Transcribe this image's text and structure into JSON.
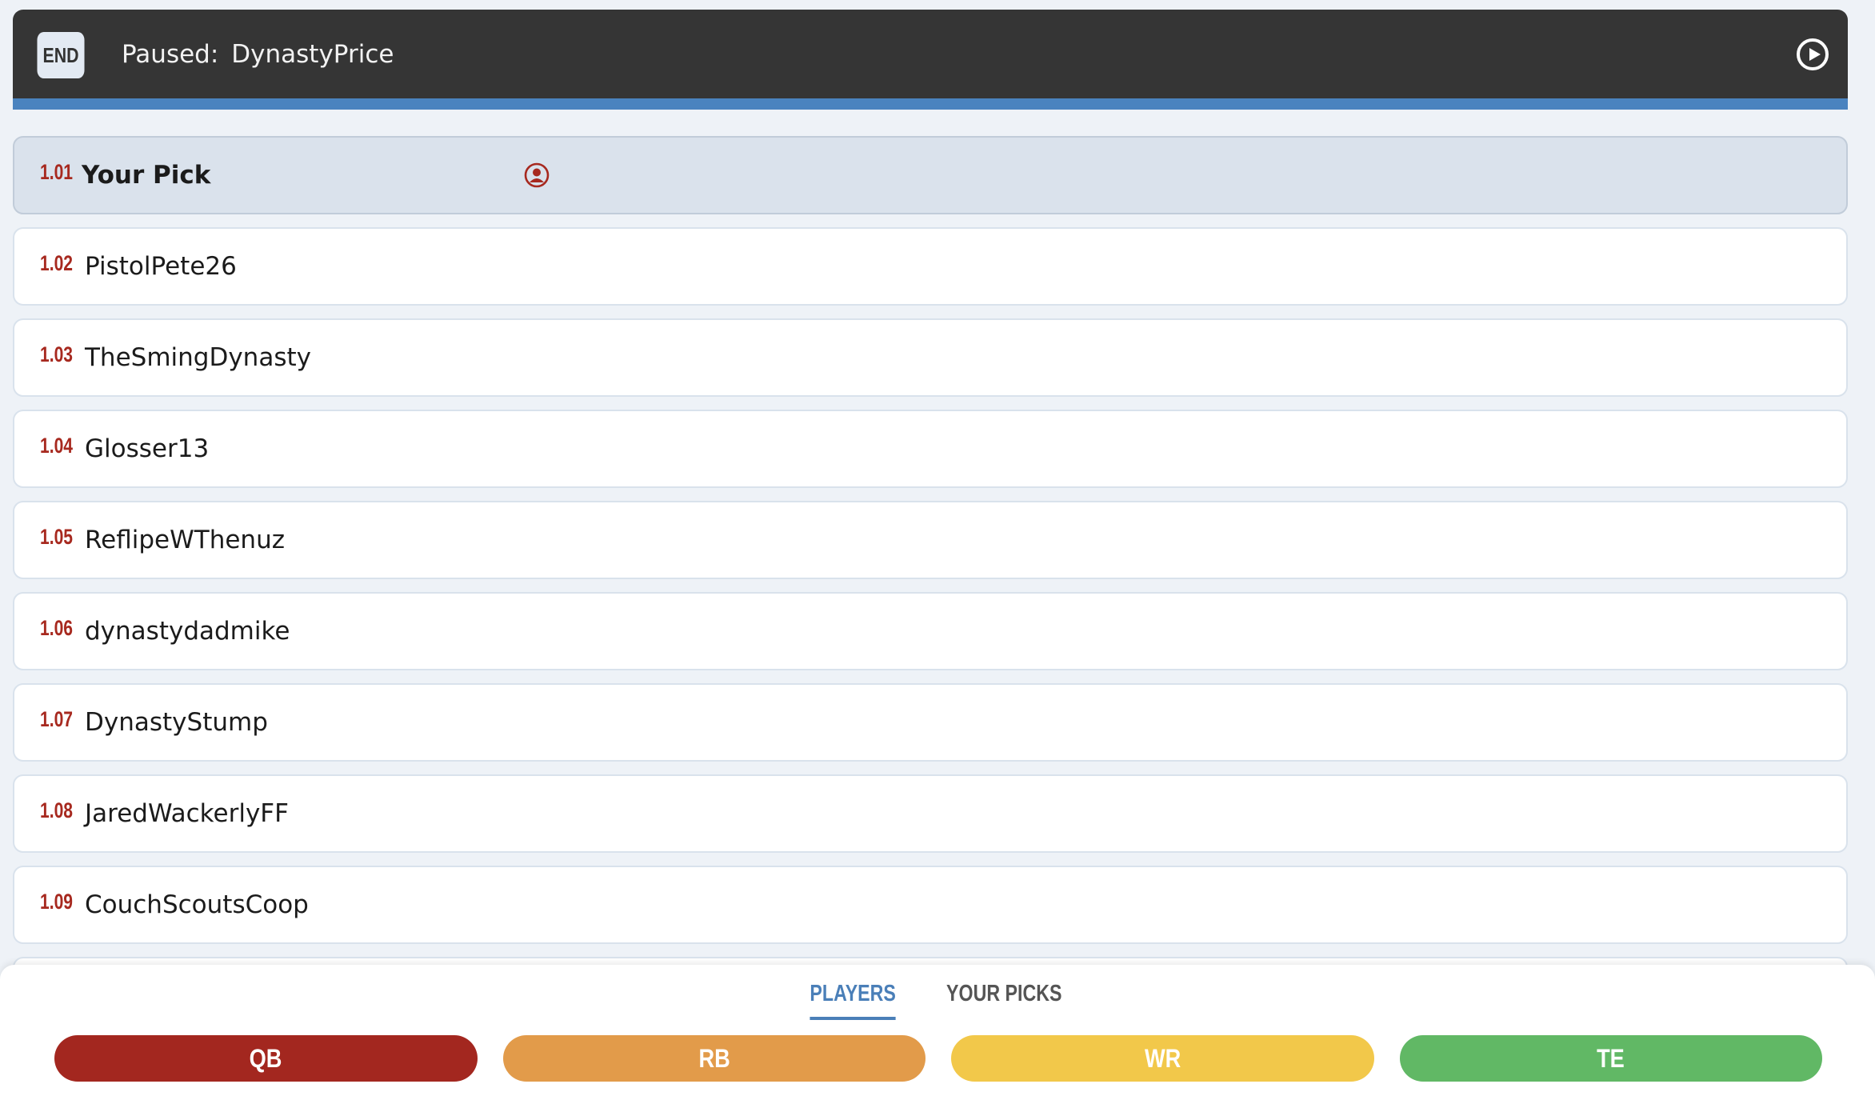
{
  "header": {
    "end_label": "END",
    "status_label": "Paused:",
    "status_user": "DynastyPrice"
  },
  "picks": [
    {
      "num": "1.01",
      "name": "Your Pick",
      "mine": true
    },
    {
      "num": "1.02",
      "name": "PistolPete26"
    },
    {
      "num": "1.03",
      "name": "TheSmingDynasty"
    },
    {
      "num": "1.04",
      "name": "Glosser13"
    },
    {
      "num": "1.05",
      "name": "ReflipeWThenuz"
    },
    {
      "num": "1.06",
      "name": "dynastydadmike"
    },
    {
      "num": "1.07",
      "name": "DynastyStump"
    },
    {
      "num": "1.08",
      "name": "JaredWackerlyFF"
    },
    {
      "num": "1.09",
      "name": "CouchScoutsCoop"
    }
  ],
  "tabs": {
    "players": "PLAYERS",
    "your_picks": "YOUR PICKS"
  },
  "positions": {
    "qb": "QB",
    "rb": "RB",
    "wr": "WR",
    "te": "TE"
  },
  "colors": {
    "qb": "#a3271f",
    "rb": "#e29b4a",
    "wr": "#f2c84a",
    "te": "#61b865",
    "accent": "#4a83bf"
  }
}
